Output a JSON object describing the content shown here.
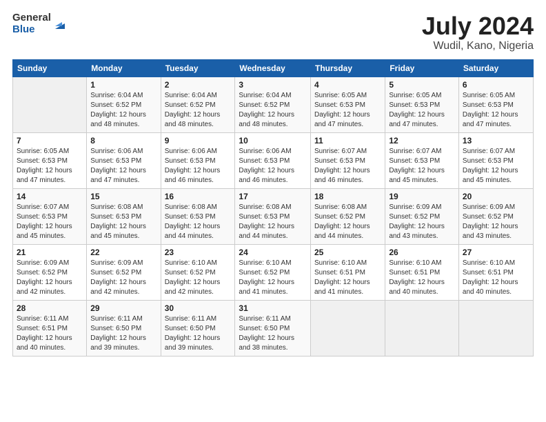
{
  "header": {
    "logo_general": "General",
    "logo_blue": "Blue",
    "title": "July 2024",
    "location": "Wudil, Kano, Nigeria"
  },
  "days_of_week": [
    "Sunday",
    "Monday",
    "Tuesday",
    "Wednesday",
    "Thursday",
    "Friday",
    "Saturday"
  ],
  "weeks": [
    [
      {
        "num": "",
        "sunrise": "",
        "sunset": "",
        "daylight": ""
      },
      {
        "num": "1",
        "sunrise": "Sunrise: 6:04 AM",
        "sunset": "Sunset: 6:52 PM",
        "daylight": "Daylight: 12 hours and 48 minutes."
      },
      {
        "num": "2",
        "sunrise": "Sunrise: 6:04 AM",
        "sunset": "Sunset: 6:52 PM",
        "daylight": "Daylight: 12 hours and 48 minutes."
      },
      {
        "num": "3",
        "sunrise": "Sunrise: 6:04 AM",
        "sunset": "Sunset: 6:52 PM",
        "daylight": "Daylight: 12 hours and 48 minutes."
      },
      {
        "num": "4",
        "sunrise": "Sunrise: 6:05 AM",
        "sunset": "Sunset: 6:53 PM",
        "daylight": "Daylight: 12 hours and 47 minutes."
      },
      {
        "num": "5",
        "sunrise": "Sunrise: 6:05 AM",
        "sunset": "Sunset: 6:53 PM",
        "daylight": "Daylight: 12 hours and 47 minutes."
      },
      {
        "num": "6",
        "sunrise": "Sunrise: 6:05 AM",
        "sunset": "Sunset: 6:53 PM",
        "daylight": "Daylight: 12 hours and 47 minutes."
      }
    ],
    [
      {
        "num": "7",
        "sunrise": "Sunrise: 6:05 AM",
        "sunset": "Sunset: 6:53 PM",
        "daylight": "Daylight: 12 hours and 47 minutes."
      },
      {
        "num": "8",
        "sunrise": "Sunrise: 6:06 AM",
        "sunset": "Sunset: 6:53 PM",
        "daylight": "Daylight: 12 hours and 47 minutes."
      },
      {
        "num": "9",
        "sunrise": "Sunrise: 6:06 AM",
        "sunset": "Sunset: 6:53 PM",
        "daylight": "Daylight: 12 hours and 46 minutes."
      },
      {
        "num": "10",
        "sunrise": "Sunrise: 6:06 AM",
        "sunset": "Sunset: 6:53 PM",
        "daylight": "Daylight: 12 hours and 46 minutes."
      },
      {
        "num": "11",
        "sunrise": "Sunrise: 6:07 AM",
        "sunset": "Sunset: 6:53 PM",
        "daylight": "Daylight: 12 hours and 46 minutes."
      },
      {
        "num": "12",
        "sunrise": "Sunrise: 6:07 AM",
        "sunset": "Sunset: 6:53 PM",
        "daylight": "Daylight: 12 hours and 45 minutes."
      },
      {
        "num": "13",
        "sunrise": "Sunrise: 6:07 AM",
        "sunset": "Sunset: 6:53 PM",
        "daylight": "Daylight: 12 hours and 45 minutes."
      }
    ],
    [
      {
        "num": "14",
        "sunrise": "Sunrise: 6:07 AM",
        "sunset": "Sunset: 6:53 PM",
        "daylight": "Daylight: 12 hours and 45 minutes."
      },
      {
        "num": "15",
        "sunrise": "Sunrise: 6:08 AM",
        "sunset": "Sunset: 6:53 PM",
        "daylight": "Daylight: 12 hours and 45 minutes."
      },
      {
        "num": "16",
        "sunrise": "Sunrise: 6:08 AM",
        "sunset": "Sunset: 6:53 PM",
        "daylight": "Daylight: 12 hours and 44 minutes."
      },
      {
        "num": "17",
        "sunrise": "Sunrise: 6:08 AM",
        "sunset": "Sunset: 6:53 PM",
        "daylight": "Daylight: 12 hours and 44 minutes."
      },
      {
        "num": "18",
        "sunrise": "Sunrise: 6:08 AM",
        "sunset": "Sunset: 6:52 PM",
        "daylight": "Daylight: 12 hours and 44 minutes."
      },
      {
        "num": "19",
        "sunrise": "Sunrise: 6:09 AM",
        "sunset": "Sunset: 6:52 PM",
        "daylight": "Daylight: 12 hours and 43 minutes."
      },
      {
        "num": "20",
        "sunrise": "Sunrise: 6:09 AM",
        "sunset": "Sunset: 6:52 PM",
        "daylight": "Daylight: 12 hours and 43 minutes."
      }
    ],
    [
      {
        "num": "21",
        "sunrise": "Sunrise: 6:09 AM",
        "sunset": "Sunset: 6:52 PM",
        "daylight": "Daylight: 12 hours and 42 minutes."
      },
      {
        "num": "22",
        "sunrise": "Sunrise: 6:09 AM",
        "sunset": "Sunset: 6:52 PM",
        "daylight": "Daylight: 12 hours and 42 minutes."
      },
      {
        "num": "23",
        "sunrise": "Sunrise: 6:10 AM",
        "sunset": "Sunset: 6:52 PM",
        "daylight": "Daylight: 12 hours and 42 minutes."
      },
      {
        "num": "24",
        "sunrise": "Sunrise: 6:10 AM",
        "sunset": "Sunset: 6:52 PM",
        "daylight": "Daylight: 12 hours and 41 minutes."
      },
      {
        "num": "25",
        "sunrise": "Sunrise: 6:10 AM",
        "sunset": "Sunset: 6:51 PM",
        "daylight": "Daylight: 12 hours and 41 minutes."
      },
      {
        "num": "26",
        "sunrise": "Sunrise: 6:10 AM",
        "sunset": "Sunset: 6:51 PM",
        "daylight": "Daylight: 12 hours and 40 minutes."
      },
      {
        "num": "27",
        "sunrise": "Sunrise: 6:10 AM",
        "sunset": "Sunset: 6:51 PM",
        "daylight": "Daylight: 12 hours and 40 minutes."
      }
    ],
    [
      {
        "num": "28",
        "sunrise": "Sunrise: 6:11 AM",
        "sunset": "Sunset: 6:51 PM",
        "daylight": "Daylight: 12 hours and 40 minutes."
      },
      {
        "num": "29",
        "sunrise": "Sunrise: 6:11 AM",
        "sunset": "Sunset: 6:50 PM",
        "daylight": "Daylight: 12 hours and 39 minutes."
      },
      {
        "num": "30",
        "sunrise": "Sunrise: 6:11 AM",
        "sunset": "Sunset: 6:50 PM",
        "daylight": "Daylight: 12 hours and 39 minutes."
      },
      {
        "num": "31",
        "sunrise": "Sunrise: 6:11 AM",
        "sunset": "Sunset: 6:50 PM",
        "daylight": "Daylight: 12 hours and 38 minutes."
      },
      {
        "num": "",
        "sunrise": "",
        "sunset": "",
        "daylight": ""
      },
      {
        "num": "",
        "sunrise": "",
        "sunset": "",
        "daylight": ""
      },
      {
        "num": "",
        "sunrise": "",
        "sunset": "",
        "daylight": ""
      }
    ]
  ]
}
